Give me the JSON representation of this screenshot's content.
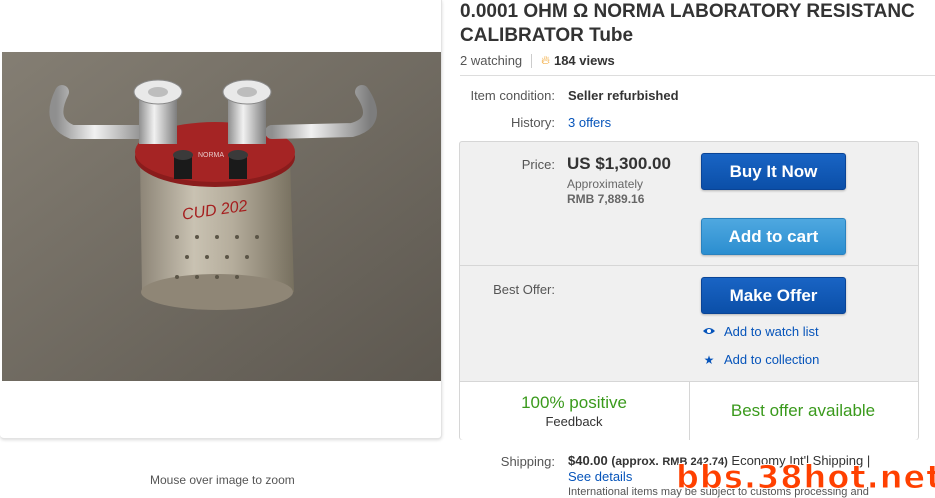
{
  "listing": {
    "title": "0.0001 OHM Ω NORMA LABORATORY RESISTANC",
    "title_line2": "CALIBRATOR Tube",
    "watching": "2 watching",
    "views": "184 views"
  },
  "details": {
    "condition_label": "Item condition:",
    "condition_value": "Seller refurbished",
    "history_label": "History:",
    "history_value": "3 offers"
  },
  "price": {
    "label": "Price:",
    "value": "US $1,300.00",
    "approx_label": "Approximately",
    "approx_value": "RMB 7,889.16"
  },
  "buttons": {
    "buy_now": "Buy It Now",
    "add_to_cart": "Add to cart",
    "make_offer": "Make Offer"
  },
  "best_offer_label": "Best Offer:",
  "links": {
    "watch": "Add to watch list",
    "collection": "Add to collection"
  },
  "feedback": {
    "positive": "100% positive",
    "label": "Feedback",
    "offer_available": "Best offer available"
  },
  "shipping": {
    "label": "Shipping:",
    "amount": "$40.00",
    "approx": "(approx.",
    "rmb": "RMB 242.74)",
    "service": "Economy Int'l Shipping |",
    "see_details": "See details",
    "note": "International items may be subject to customs processing and"
  },
  "image": {
    "zoom_hint": "Mouse over image to zoom",
    "photo_text": "NORMA"
  },
  "watermark": "bbs.38hot.net",
  "icons": [
    "flame-icon",
    "eye-icon",
    "star-icon"
  ],
  "colors": {
    "accent_blue": "#0654ba",
    "button_blue": "#0b4fa8",
    "cart_blue": "#2b8ed0",
    "positive_green": "#3a9a1c"
  }
}
